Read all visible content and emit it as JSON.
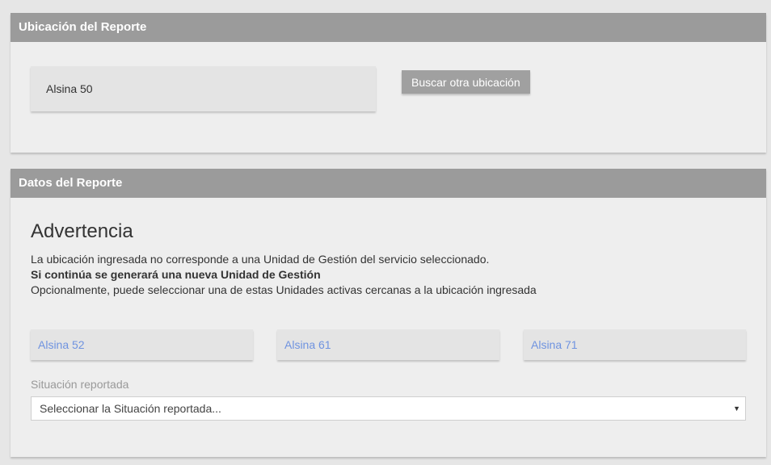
{
  "location_panel": {
    "title": "Ubicación del Reporte",
    "address": "Alsina 50",
    "search_button": "Buscar otra ubicación"
  },
  "data_panel": {
    "title": "Datos del Reporte",
    "warning": {
      "title": "Advertencia",
      "line1": "La ubicación ingresada no corresponde a una Unidad de Gestión del servicio seleccionado.",
      "line2": "Si continúa se generará una nueva Unidad de Gestión",
      "line3": "Opcionalmente, puede seleccionar una de estas Unidades activas cercanas a la ubicación ingresada"
    },
    "nearby_units": [
      {
        "label": "Alsina 52"
      },
      {
        "label": "Alsina 61"
      },
      {
        "label": "Alsina 71"
      }
    ],
    "situation": {
      "label": "Situación reportada",
      "selected": "Seleccionar la Situación reportada..."
    }
  },
  "colors": {
    "header_bg": "#9b9b9b",
    "panel_bg": "#eeeeee",
    "link": "#6f93e0",
    "button_bg": "#a0a0a0"
  }
}
